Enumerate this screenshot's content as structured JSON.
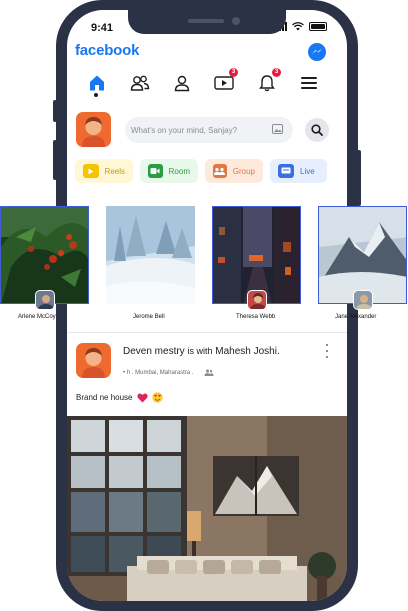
{
  "status_bar": {
    "time": "9:41"
  },
  "header": {
    "logo": "facebook",
    "nav": [
      {
        "icon": "home-icon",
        "active": true
      },
      {
        "icon": "friends-icon"
      },
      {
        "icon": "profile-icon"
      },
      {
        "icon": "video-icon",
        "badge": "3"
      },
      {
        "icon": "bell-icon",
        "badge": "3"
      },
      {
        "icon": "menu-icon"
      }
    ]
  },
  "composer": {
    "placeholder": "What's on your mind, Sanjay?"
  },
  "shortcuts": [
    {
      "label": "Reels",
      "color": "#f5c400"
    },
    {
      "label": "Room",
      "color": "#2a9d43"
    },
    {
      "label": "Group",
      "color": "#e07846"
    },
    {
      "label": "Live",
      "color": "#3b6ee0"
    }
  ],
  "stories": [
    {
      "name": "Arlene McCoy"
    },
    {
      "name": "Jerome Bell"
    },
    {
      "name": "Theresa Webb"
    },
    {
      "name": "Jane Alexander"
    }
  ],
  "post": {
    "author": "Deven mestry",
    "with_text": "is with",
    "tagged": "Mahesh Joshi.",
    "meta": "• h . Mumbai, Maharastra .",
    "text": "Brand ne house",
    "emojis": [
      "heart",
      "heart-eyes"
    ]
  },
  "colors": {
    "brand": "#1877f2",
    "badge": "#e41e3f",
    "frame": "#2b3246"
  }
}
